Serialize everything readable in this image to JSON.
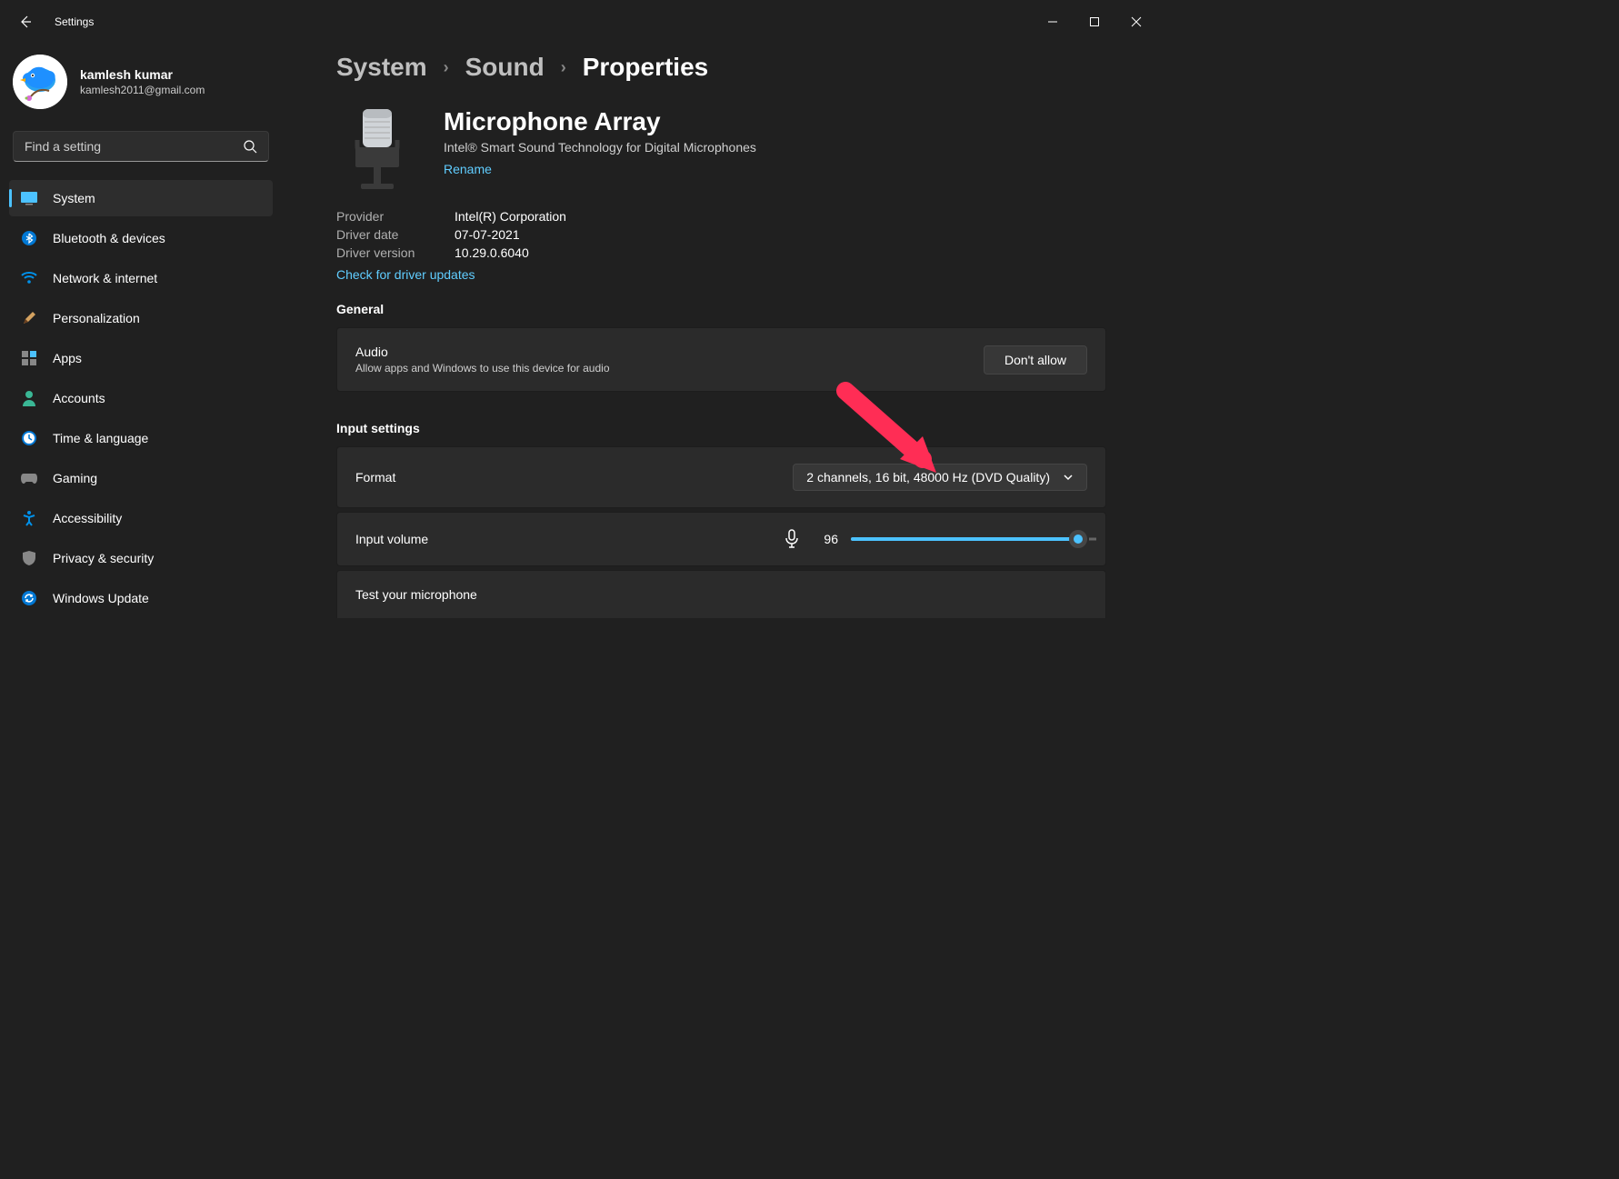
{
  "app_title": "Settings",
  "profile": {
    "name": "kamlesh kumar",
    "email": "kamlesh2011@gmail.com"
  },
  "search": {
    "placeholder": "Find a setting"
  },
  "nav": {
    "items": [
      {
        "label": "System"
      },
      {
        "label": "Bluetooth & devices"
      },
      {
        "label": "Network & internet"
      },
      {
        "label": "Personalization"
      },
      {
        "label": "Apps"
      },
      {
        "label": "Accounts"
      },
      {
        "label": "Time & language"
      },
      {
        "label": "Gaming"
      },
      {
        "label": "Accessibility"
      },
      {
        "label": "Privacy & security"
      },
      {
        "label": "Windows Update"
      }
    ]
  },
  "breadcrumb": {
    "a": "System",
    "b": "Sound",
    "c": "Properties"
  },
  "device": {
    "name": "Microphone Array",
    "sub": "Intel® Smart Sound Technology for Digital Microphones",
    "rename": "Rename"
  },
  "meta": {
    "provider_label": "Provider",
    "provider_value": "Intel(R) Corporation",
    "date_label": "Driver date",
    "date_value": "07-07-2021",
    "ver_label": "Driver version",
    "ver_value": "10.29.0.6040",
    "check_link": "Check for driver updates"
  },
  "general": {
    "title": "General",
    "audio_title": "Audio",
    "audio_desc": "Allow apps and Windows to use this device for audio",
    "dont_allow": "Don't allow"
  },
  "input": {
    "title": "Input settings",
    "format_label": "Format",
    "format_value": "2 channels, 16 bit, 48000 Hz (DVD Quality)",
    "volume_label": "Input volume",
    "volume_value": "96",
    "test_label": "Test your microphone"
  }
}
